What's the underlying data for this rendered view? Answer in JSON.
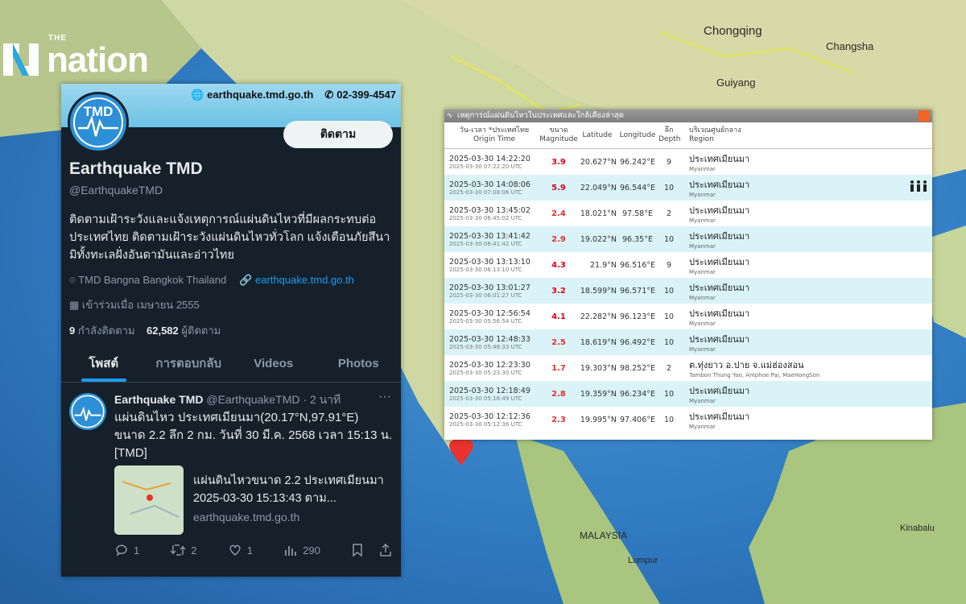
{
  "logo": {
    "small": "THE",
    "big": "nation"
  },
  "map_labels": {
    "chongqing": "Chongqing",
    "changsha": "Changsha",
    "guiyang": "Guiyang",
    "malaysia": "MALAYSIA",
    "lumpur": "Lumpur",
    "kinabalu": "Kinabalu"
  },
  "twitter": {
    "website": "earthquake.tmd.go.th",
    "phone": "02-399-4547",
    "avatar_text": "TMD",
    "follow_label": "ติดตาม",
    "name": "Earthquake TMD",
    "handle": "@EarthquakeTMD",
    "bio": "ติดตามเฝ้าระวังและแจ้งเหตุการณ์แผ่นดินไหวที่มีผลกระทบต่อประเทศไทย ติดตามเฝ้าระวังแผ่นดินไหวทั่วโลก แจ้งเตือนภัยสึนามิทั้งทะเลฝั่งอันดามันและอ่าวไทย",
    "location": "TMD Bangna Bangkok Thailand",
    "link": "earthquake.tmd.go.th",
    "joined": "เข้าร่วมเมื่อ เมษายน 2555",
    "following_count": "9",
    "following_label": "กำลังติดตาม",
    "followers_count": "62,582",
    "followers_label": "ผู้ติดตาม",
    "tabs": [
      "โพสต์",
      "การตอบกลับ",
      "Videos",
      "Photos"
    ],
    "tweet": {
      "name": "Earthquake TMD",
      "handle_time": "@EarthquakeTMD · 2 นาที",
      "more": "···",
      "text": "แผ่นดินไหว ประเทศเมียนมา(20.17°N,97.91°E) ขนาด 2.2  ลึก 2 กม. วันที่ 30 มี.ค. 2568 เวลา 15:13 น. [TMD]",
      "card_title": "แผ่นดินไหวขนาด 2.2 ประเทศเมียนมา 2025-03-30 15:13:43 ตาม...",
      "card_domain": "earthquake.tmd.go.th",
      "replies": "1",
      "retweets": "2",
      "likes": "1",
      "views": "290"
    }
  },
  "table": {
    "title": "เหตุการณ์แผ่นดินไหวในประเทศและใกล้เคียงล่าสุด",
    "headers": {
      "time_th": "วัน-เวลา *ประเทศไทย",
      "time_en": "Origin Time",
      "mag_th": "ขนาด",
      "mag_en": "Magnitude",
      "lat": "Latitude",
      "lon": "Longitude",
      "depth_th": "ลึก",
      "depth_en": "Depth",
      "region_th": "บริเวณศูนย์กลาง",
      "region_en": "Region"
    },
    "rows": [
      {
        "local": "2025-03-30 14:22:20",
        "utc": "2025-03-30 07:22:20 UTC",
        "mag": "3.9",
        "lat": "20.627°N",
        "lon": "96.242°E",
        "depth": "9",
        "region_th": "ประเทศเมียนมา",
        "region_en": "Myanmar",
        "icon": ""
      },
      {
        "local": "2025-03-30 14:08:06",
        "utc": "2025-03-30 07:08:06 UTC",
        "mag": "5.9",
        "lat": "22.049°N",
        "lon": "96.544°E",
        "depth": "10",
        "region_th": "ประเทศเมียนมา",
        "region_en": "Myanmar",
        "icon": "people-icon"
      },
      {
        "local": "2025-03-30 13:45:02",
        "utc": "2025-03-30 06:45:02 UTC",
        "mag": "2.4",
        "lat": "18.021°N",
        "lon": "97.58°E",
        "depth": "2",
        "region_th": "ประเทศเมียนมา",
        "region_en": "Myanmar",
        "icon": ""
      },
      {
        "local": "2025-03-30 13:41:42",
        "utc": "2025-03-30 06:41:42 UTC",
        "mag": "2.9",
        "lat": "19.022°N",
        "lon": "96.35°E",
        "depth": "10",
        "region_th": "ประเทศเมียนมา",
        "region_en": "Myanmar",
        "icon": ""
      },
      {
        "local": "2025-03-30 13:13:10",
        "utc": "2025-03-30 06:13:10 UTC",
        "mag": "4.3",
        "lat": "21.9°N",
        "lon": "96.516°E",
        "depth": "9",
        "region_th": "ประเทศเมียนมา",
        "region_en": "Myanmar",
        "icon": ""
      },
      {
        "local": "2025-03-30 13:01:27",
        "utc": "2025-03-30 06:01:27 UTC",
        "mag": "3.2",
        "lat": "18.599°N",
        "lon": "96.571°E",
        "depth": "10",
        "region_th": "ประเทศเมียนมา",
        "region_en": "Myanmar",
        "icon": ""
      },
      {
        "local": "2025-03-30 12:56:54",
        "utc": "2025-03-30 05:56:54 UTC",
        "mag": "4.1",
        "lat": "22.282°N",
        "lon": "96.123°E",
        "depth": "10",
        "region_th": "ประเทศเมียนมา",
        "region_en": "Myanmar",
        "icon": ""
      },
      {
        "local": "2025-03-30 12:48:33",
        "utc": "2025-03-30 05:48:33 UTC",
        "mag": "2.5",
        "lat": "18.619°N",
        "lon": "96.492°E",
        "depth": "10",
        "region_th": "ประเทศเมียนมา",
        "region_en": "Myanmar",
        "icon": ""
      },
      {
        "local": "2025-03-30 12:23:30",
        "utc": "2025-03-30 05:23:30 UTC",
        "mag": "1.7",
        "lat": "19.303°N",
        "lon": "98.252°E",
        "depth": "2",
        "region_th": "ต.ทุ่งยาว อ.ปาย จ.แม่ฮ่องสอน",
        "region_en": "Tambon Thung Yao, Amphoe Pai, MaeHongSon",
        "icon": ""
      },
      {
        "local": "2025-03-30 12:18:49",
        "utc": "2025-03-30 05:18:49 UTC",
        "mag": "2.8",
        "lat": "19.359°N",
        "lon": "96.234°E",
        "depth": "10",
        "region_th": "ประเทศเมียนมา",
        "region_en": "Myanmar",
        "icon": ""
      },
      {
        "local": "2025-03-30 12:12:36",
        "utc": "2025-03-30 05:12:36 UTC",
        "mag": "2.3",
        "lat": "19.995°N",
        "lon": "97.406°E",
        "depth": "10",
        "region_th": "ประเทศเมียนมา",
        "region_en": "Myanmar",
        "icon": ""
      }
    ]
  },
  "colors": {
    "mag_high": "#d0021b",
    "mag_mid": "#e0001a",
    "mag_low": "#e2312f",
    "twitter_bg": "#15202b",
    "twitter_accent": "#1d9bf0"
  }
}
